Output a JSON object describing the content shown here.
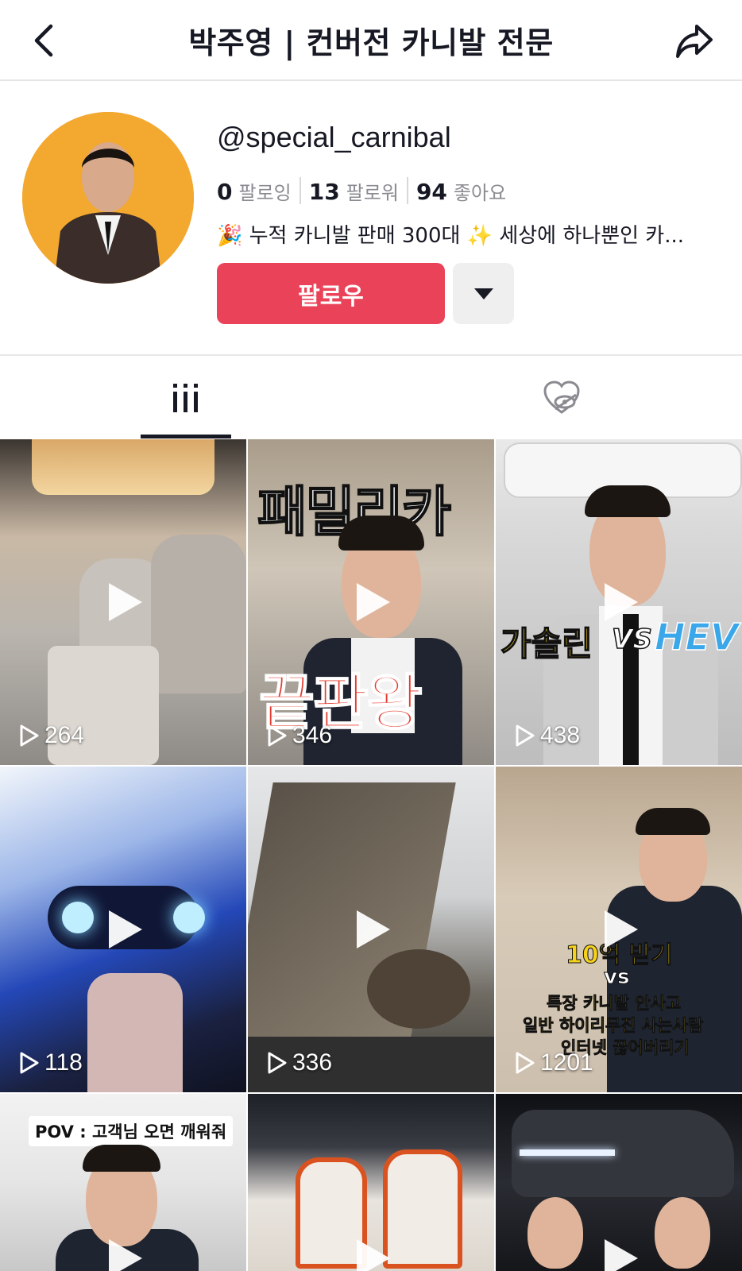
{
  "header": {
    "title": "박주영 | 컨버전 카니발 전문",
    "back_icon": "chevron-left-icon",
    "share_icon": "share-arrow-icon"
  },
  "profile": {
    "username": "@special_carnibal",
    "stats": [
      {
        "num": "0",
        "label": "팔로잉"
      },
      {
        "num": "13",
        "label": "팔로워"
      },
      {
        "num": "94",
        "label": "좋아요"
      }
    ],
    "bio_emoji_1": "🎉",
    "bio_text_1": " 누적 카니발 판매 300대 ",
    "bio_emoji_2": "✨",
    "bio_text_2": " 세상에 하나뿐인 카...",
    "follow_label": "팔로우",
    "avatar_bg": "#f3a830"
  },
  "tabs": {
    "videos_icon": "grid-bars-icon",
    "liked_icon": "heart-hidden-icon"
  },
  "videos": [
    {
      "views": "264",
      "overlay": ""
    },
    {
      "views": "346",
      "overlay_top": "패밀리카",
      "overlay_bottom": "끝판왕"
    },
    {
      "views": "438",
      "overlay_left": "가솔린",
      "overlay_vs": "VS",
      "overlay_right": "HEV"
    },
    {
      "views": "118",
      "overlay": ""
    },
    {
      "views": "336",
      "overlay": ""
    },
    {
      "views": "1201",
      "overlay_line1": "10억 받기",
      "overlay_line2": "vs",
      "overlay_line3": "특장 카니발 안사고",
      "overlay_line4": "일반 하이리무진 사는사람",
      "overlay_line5": "인터넷 끊어버리기"
    },
    {
      "views": "",
      "pov": "POV : 고객님 오면 깨워줘"
    },
    {
      "views": ""
    },
    {
      "views": ""
    }
  ],
  "colors": {
    "follow": "#ea4359",
    "text": "#161823",
    "muted": "#8a8b91"
  }
}
